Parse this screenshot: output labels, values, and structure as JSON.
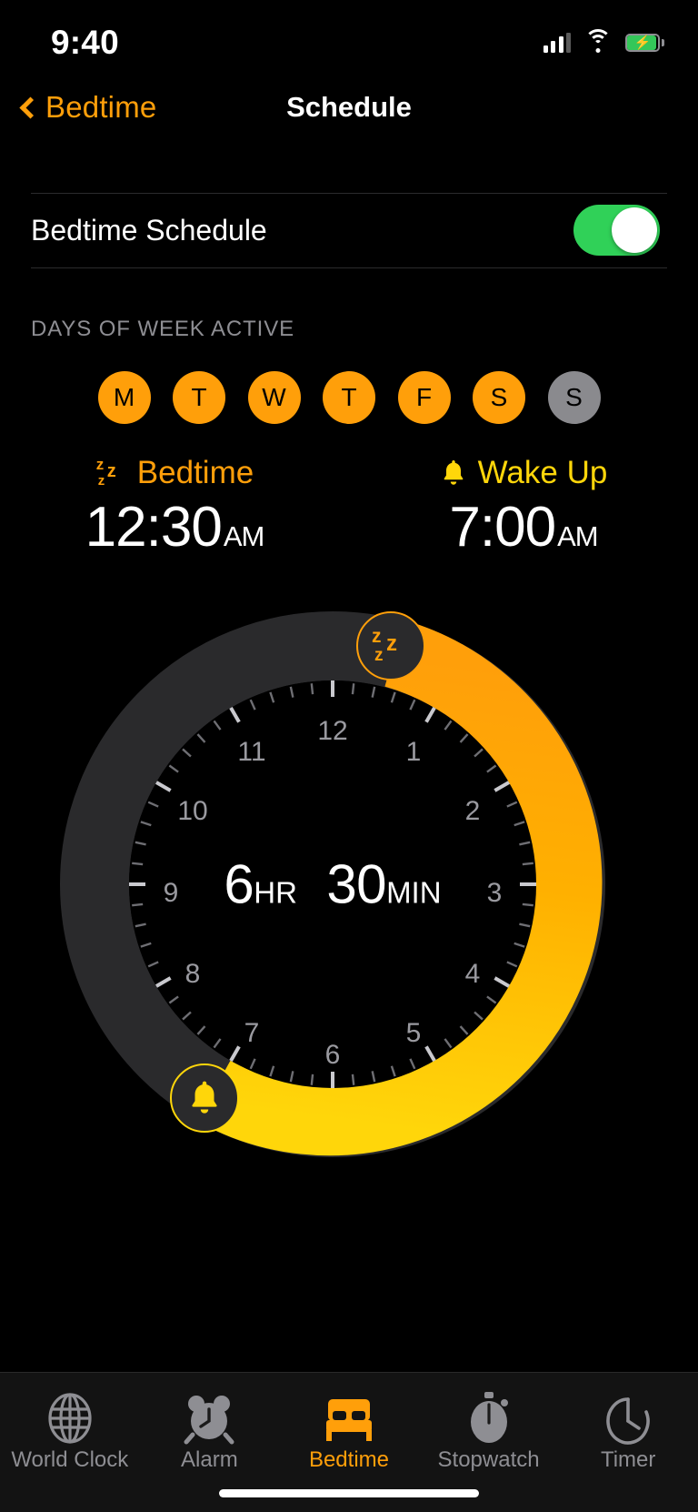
{
  "status_bar": {
    "time": "9:40",
    "cellular_icon": "cellular-signal-icon",
    "wifi_icon": "wifi-icon",
    "battery_icon": "battery-charging-icon",
    "battery_charging": true
  },
  "nav": {
    "back_label": "Bedtime",
    "back_icon": "chevron-left-icon",
    "title": "Schedule"
  },
  "schedule_toggle": {
    "label": "Bedtime Schedule",
    "value": "on"
  },
  "days_section": {
    "header": "DAYS OF WEEK ACTIVE",
    "days": [
      {
        "letter": "M",
        "name": "monday",
        "active": true
      },
      {
        "letter": "T",
        "name": "tuesday",
        "active": true
      },
      {
        "letter": "W",
        "name": "wednesday",
        "active": true
      },
      {
        "letter": "T",
        "name": "thursday",
        "active": true
      },
      {
        "letter": "F",
        "name": "friday",
        "active": true
      },
      {
        "letter": "S",
        "name": "saturday",
        "active": true
      },
      {
        "letter": "S",
        "name": "sunday",
        "active": false
      }
    ]
  },
  "bedtime": {
    "label": "Bedtime",
    "icon": "zzz-icon",
    "time": "12:30",
    "ampm": "AM"
  },
  "wakeup": {
    "label": "Wake Up",
    "icon": "bell-icon",
    "time": "7:00",
    "ampm": "AM"
  },
  "dial": {
    "duration_value": "6",
    "duration_unit": "HR",
    "duration_value2": "30",
    "duration_unit2": "MIN",
    "hour_labels": [
      "12",
      "1",
      "2",
      "3",
      "4",
      "5",
      "6",
      "7",
      "8",
      "9",
      "10",
      "11"
    ],
    "bedtime_handle_icon": "zzz-icon",
    "wakeup_handle_icon": "bell-icon"
  },
  "tabs": [
    {
      "label": "World Clock",
      "icon": "globe-icon",
      "active": false
    },
    {
      "label": "Alarm",
      "icon": "alarm-icon",
      "active": false
    },
    {
      "label": "Bedtime",
      "icon": "bed-icon",
      "active": true
    },
    {
      "label": "Stopwatch",
      "icon": "stopwatch-icon",
      "active": false
    },
    {
      "label": "Timer",
      "icon": "timer-icon",
      "active": false
    }
  ],
  "colors": {
    "background": "#000000",
    "bedtime_orange": "#ff9f0a",
    "wakeup_yellow": "#ffd60a",
    "toggle_green": "#30d158",
    "inactive_gray": "#8a8a8e",
    "track_dark": "#2a2a2c"
  }
}
